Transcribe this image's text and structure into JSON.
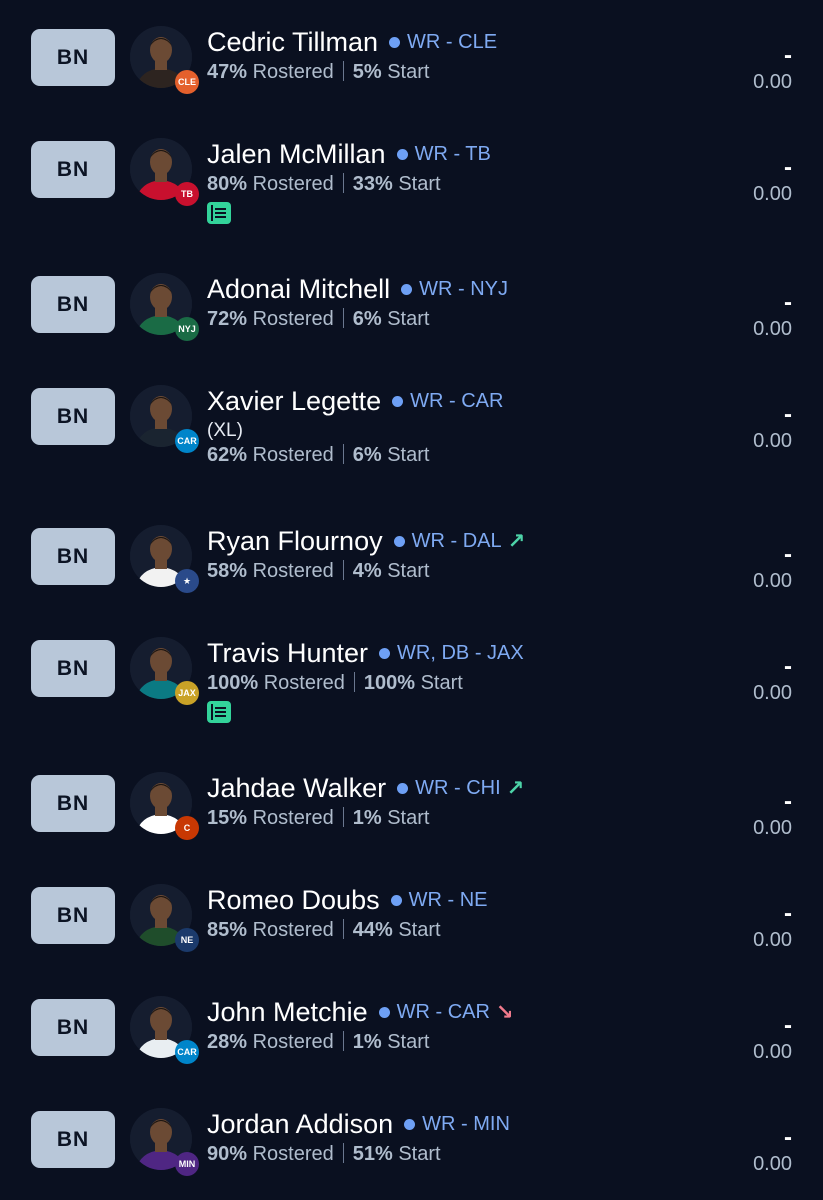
{
  "players": [
    {
      "slot": "BN",
      "name": "Cedric Tillman",
      "position": "WR - CLE",
      "nickname": "",
      "rostered_pct": "47%",
      "rostered_label": "Rostered",
      "start_pct": "5%",
      "start_label": "Start",
      "has_news": false,
      "trend": "",
      "trend_icon": "",
      "team_color": "#e4602c",
      "team_abbr": "CLE",
      "jersey": "#2d2420",
      "proj": "-",
      "points": "0.00"
    },
    {
      "slot": "BN",
      "name": "Jalen McMillan",
      "position": "WR - TB",
      "nickname": "",
      "rostered_pct": "80%",
      "rostered_label": "Rostered",
      "start_pct": "33%",
      "start_label": "Start",
      "has_news": true,
      "trend": "",
      "trend_icon": "",
      "team_color": "#c8102e",
      "team_abbr": "TB",
      "jersey": "#c8102e",
      "proj": "-",
      "points": "0.00"
    },
    {
      "slot": "BN",
      "name": "Adonai Mitchell",
      "position": "WR - NYJ",
      "nickname": "",
      "rostered_pct": "72%",
      "rostered_label": "Rostered",
      "start_pct": "6%",
      "start_label": "Start",
      "has_news": false,
      "trend": "",
      "trend_icon": "",
      "team_color": "#1a6b45",
      "team_abbr": "NYJ",
      "jersey": "#1a6b45",
      "proj": "-",
      "points": "0.00"
    },
    {
      "slot": "BN",
      "name": "Xavier Legette",
      "position": "WR - CAR",
      "nickname": "(XL)",
      "rostered_pct": "62%",
      "rostered_label": "Rostered",
      "start_pct": "6%",
      "start_label": "Start",
      "has_news": false,
      "trend": "",
      "trend_icon": "",
      "team_color": "#0085ca",
      "team_abbr": "CAR",
      "jersey": "#1a2430",
      "proj": "-",
      "points": "0.00"
    },
    {
      "slot": "BN",
      "name": "Ryan Flournoy",
      "position": "WR - DAL",
      "nickname": "",
      "rostered_pct": "58%",
      "rostered_label": "Rostered",
      "start_pct": "4%",
      "start_label": "Start",
      "has_news": false,
      "trend": "up",
      "trend_icon": "↗",
      "team_color": "#2a4a8a",
      "team_abbr": "★",
      "jersey": "#f2f2f2",
      "proj": "-",
      "points": "0.00"
    },
    {
      "slot": "BN",
      "name": "Travis Hunter",
      "position": "WR, DB - JAX",
      "nickname": "",
      "rostered_pct": "100%",
      "rostered_label": "Rostered",
      "start_pct": "100%",
      "start_label": "Start",
      "has_news": true,
      "trend": "",
      "trend_icon": "",
      "team_color": "#c9a227",
      "team_abbr": "JAX",
      "jersey": "#0b7a83",
      "proj": "-",
      "points": "0.00"
    },
    {
      "slot": "BN",
      "name": "Jahdae Walker",
      "position": "WR - CHI",
      "nickname": "",
      "rostered_pct": "15%",
      "rostered_label": "Rostered",
      "start_pct": "1%",
      "start_label": "Start",
      "has_news": false,
      "trend": "up",
      "trend_icon": "↗",
      "team_color": "#c83803",
      "team_abbr": "C",
      "jersey": "#ffffff",
      "proj": "-",
      "points": "0.00"
    },
    {
      "slot": "BN",
      "name": "Romeo Doubs",
      "position": "WR - NE",
      "nickname": "",
      "rostered_pct": "85%",
      "rostered_label": "Rostered",
      "start_pct": "44%",
      "start_label": "Start",
      "has_news": false,
      "trend": "",
      "trend_icon": "",
      "team_color": "#1b3a6b",
      "team_abbr": "NE",
      "jersey": "#1f4d2b",
      "proj": "-",
      "points": "0.00"
    },
    {
      "slot": "BN",
      "name": "John Metchie",
      "position": "WR - CAR",
      "nickname": "",
      "rostered_pct": "28%",
      "rostered_label": "Rostered",
      "start_pct": "1%",
      "start_label": "Start",
      "has_news": false,
      "trend": "down",
      "trend_icon": "↘",
      "team_color": "#0085ca",
      "team_abbr": "CAR",
      "jersey": "#e9eef2",
      "proj": "-",
      "points": "0.00"
    },
    {
      "slot": "BN",
      "name": "Jordan Addison",
      "position": "WR - MIN",
      "nickname": "",
      "rostered_pct": "90%",
      "rostered_label": "Rostered",
      "start_pct": "51%",
      "start_label": "Start",
      "has_news": false,
      "trend": "",
      "trend_icon": "",
      "team_color": "#4f2683",
      "team_abbr": "MIN",
      "jersey": "#4f2683",
      "proj": "-",
      "points": "0.00"
    }
  ]
}
